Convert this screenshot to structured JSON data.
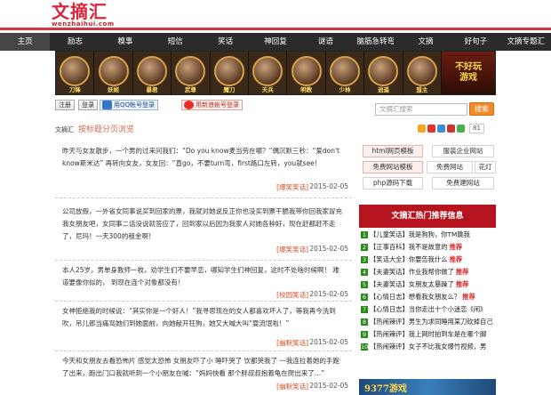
{
  "site": {
    "logo_main": "文摘汇",
    "logo_sub": "wenzhaihui.com"
  },
  "nav": [
    "主页",
    "励志",
    "糗事",
    "短信",
    "笑话",
    "神回复",
    "谜语",
    "脑筋急转弯",
    "文摘",
    "好句子",
    "文摘专题汇"
  ],
  "banner": {
    "avatars": [
      "刀锋",
      "妖姬",
      "暴君",
      "武尊",
      "魔刀",
      "天兵",
      "明教",
      "少林",
      "逍遥",
      "盟主"
    ],
    "ad_line1": "不好玩",
    "ad_line2": "游戏"
  },
  "toolbar": {
    "btn_register": "注册",
    "btn_login": "登录",
    "qq_login": "用QQ帐号登录",
    "weibo_login": "用新浪帐号登录",
    "search_placeholder": "文摘汇搜索",
    "search_button": "搜索",
    "share_count": "81"
  },
  "crumb": {
    "site": "文摘汇",
    "page": "按标题分页浏览"
  },
  "posts": [
    {
      "text": "昨天与女友散步，一个男的过来问我们：“Do you know麦当劳在哪？”偶沉默三秒：“爱don't know斯米达” 再转向女友，女友回：“直go，不要turn弯，first路口左转，you就see！",
      "tag": "[爆笑笑话]",
      "date": "2015-02-05"
    },
    {
      "text": "公司放假，一外省女同事说买到回家的票，我就对她说反正你也没买到票干脆我带你回我家冒充我女朋友吧，女同事二话没说就答应了，回到家以后因为我家人对她各种好，现在赶都赶不走了，尼玛！一天300的租金啊！",
      "tag": "[爆笑笑话]",
      "date": "2015-02-05"
    },
    {
      "text": "本人25岁，男单身教师一枚，劝学生们不要早恋，哪知学生们神回复，这时不处啥时候啊！ 难道要像你似的， 到现在连个对象都没有！",
      "tag": "[校园笑话]",
      "date": "2015-02-05"
    },
    {
      "text": "女神拒绝我的时候说：“其实你是一个好人！”我寻思现在的女人都喜欢坏人了，等我再今洗到吹，吊儿郎当痛骂她们到她面前，向她献开狂狗，她又大喊大叫“耍流氓啦！”",
      "tag": "[幽默笑话]",
      "date": "2015-02-05"
    },
    {
      "text": "今天和女朋友去看恐怖片 感觉太恐怖 女朋友吓了小 睡吓哭了 饮都哭我了 一我连拉着她的手跑了出来，跑出门口我就听到一个小朋友在喊：“妈妈快看 那个胖叔叔抱着龟在爬出来了…”",
      "tag": "[幽默笑话]",
      "date": "2015-02-05"
    }
  ],
  "sidebar": {
    "tags": [
      "html网页模板",
      "服装企业网站",
      "免费网站模板",
      "免费网站",
      "花灯",
      "php源码下载",
      "免费建网站"
    ],
    "hot_header": "文摘汇热门推荐信息",
    "hot_items": [
      {
        "n": "1",
        "title": "【儿童笑话】我是狗狗，你TM跳我",
        "rec": ""
      },
      {
        "n": "2",
        "title": "【正事百科】我不是故意的",
        "rec": "推荐"
      },
      {
        "n": "3",
        "title": "【笑话大全】你要告我什么",
        "rec": "推荐"
      },
      {
        "n": "4",
        "title": "【夫妻笑话】作业我帮你做了",
        "rec": "推荐"
      },
      {
        "n": "5",
        "title": "【夫妻笑话】女朋友太暴躁了",
        "rec": "推荐"
      },
      {
        "n": "6",
        "title": "【心情日志】想看我女朋友么？",
        "rec": "推荐"
      },
      {
        "n": "7",
        "title": "【心情日志】当你走出十个小迷恋《闲》",
        "rec": ""
      },
      {
        "n": "8",
        "title": "【热闹辣评】男生为求同睡用某刀砍掉自己",
        "rec": ""
      },
      {
        "n": "9",
        "title": "【热闹辣评】我上网时拍到车是在哪个脚",
        "rec": ""
      },
      {
        "n": "10",
        "title": "【热闹辣评】女子不比我女爆竹视频，男",
        "rec": ""
      }
    ],
    "side_ad": "9377游戏"
  }
}
